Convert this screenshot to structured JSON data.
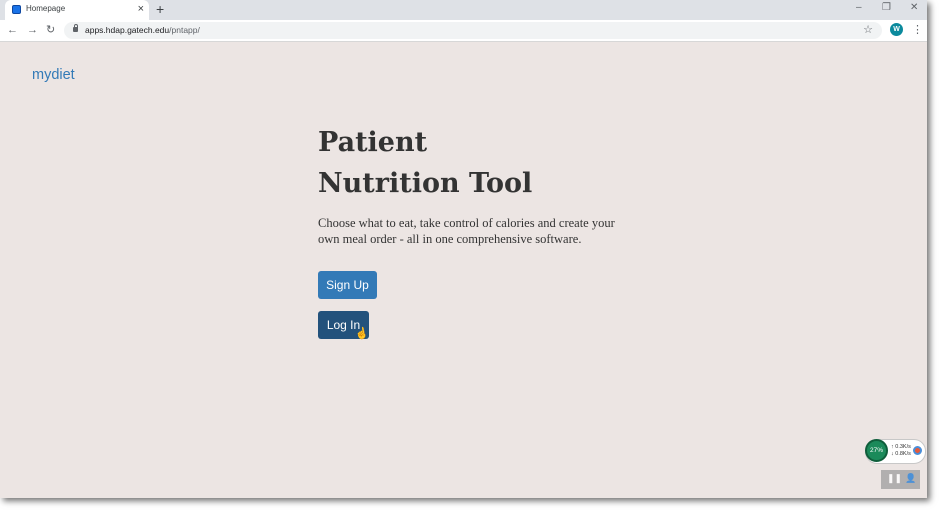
{
  "browser": {
    "tab_title": "Homepage",
    "tab_close": "×",
    "new_tab": "+",
    "window_controls": {
      "minimize": "–",
      "restore": "❐",
      "close": "✕"
    },
    "nav": {
      "back": "←",
      "forward": "→",
      "reload": "↻"
    },
    "url_host": "apps.hdap.gatech.edu",
    "url_path": "/pntapp/",
    "bookmark_star": "☆",
    "profile_initial": "W",
    "menu": "⋮"
  },
  "page": {
    "brand": "mydiet",
    "title": "Patient Nutrition Tool",
    "description": "Choose what to eat, take control of calories and create your own meal order - all in one comprehensive software.",
    "signup_label": "Sign Up",
    "login_label": "Log In"
  },
  "overlay": {
    "cpu_percent": "27%",
    "upload_speed": "↑  0.3K/s",
    "download_speed": "↓  0.8K/s",
    "pause": "❚❚",
    "person": "👤"
  },
  "colors": {
    "brand_link": "#337ab7",
    "primary_button": "#337ab7",
    "primary_button_active": "#23527c",
    "page_background": "#ece5e3"
  },
  "icons": [
    "lock-icon",
    "star-icon",
    "menu-icon",
    "back-arrow-icon",
    "forward-arrow-icon",
    "reload-icon",
    "favicon-icon",
    "cursor-hand-icon"
  ]
}
